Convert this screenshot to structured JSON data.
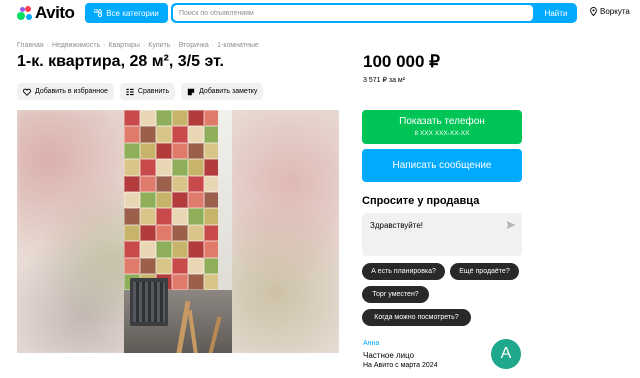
{
  "header": {
    "logo_text": "Avito",
    "categories_label": "Все категории",
    "search_placeholder": "Поиск по объявлениям",
    "search_value": "",
    "search_button": "Найти",
    "location": "Воркута"
  },
  "breadcrumb": [
    "Главная",
    "Недвижимость",
    "Квартиры",
    "Купить",
    "Вторичка",
    "1-комнатные"
  ],
  "title": "1-к. квартира, 28 м², 3/5 эт.",
  "actions": {
    "favorite": "Добавить в избранное",
    "compare": "Сравнить",
    "note": "Добавить заметку"
  },
  "price": {
    "value": "100 000 ₽",
    "per_m2": "3 571 ₽ за м²"
  },
  "contact": {
    "phone_button": "Показать телефон",
    "phone_masked": "8 XXX XXX-XX-XX",
    "message_button": "Написать сообщение"
  },
  "ask": {
    "title": "Спросите у продавца",
    "text": "Здравствуйте!",
    "chips": [
      "А есть планировка?",
      "Ещё продаёте?",
      "Торг уместен?",
      "Когда можно посмотреть?"
    ]
  },
  "seller": {
    "name": "Анна",
    "type": "Частное лицо",
    "since": "На Авито с марта 2024",
    "avatar_letter": "A",
    "avatar_color": "#1fa88c"
  },
  "colors": {
    "accent_blue": "#00aaff",
    "accent_green": "#00c456"
  }
}
